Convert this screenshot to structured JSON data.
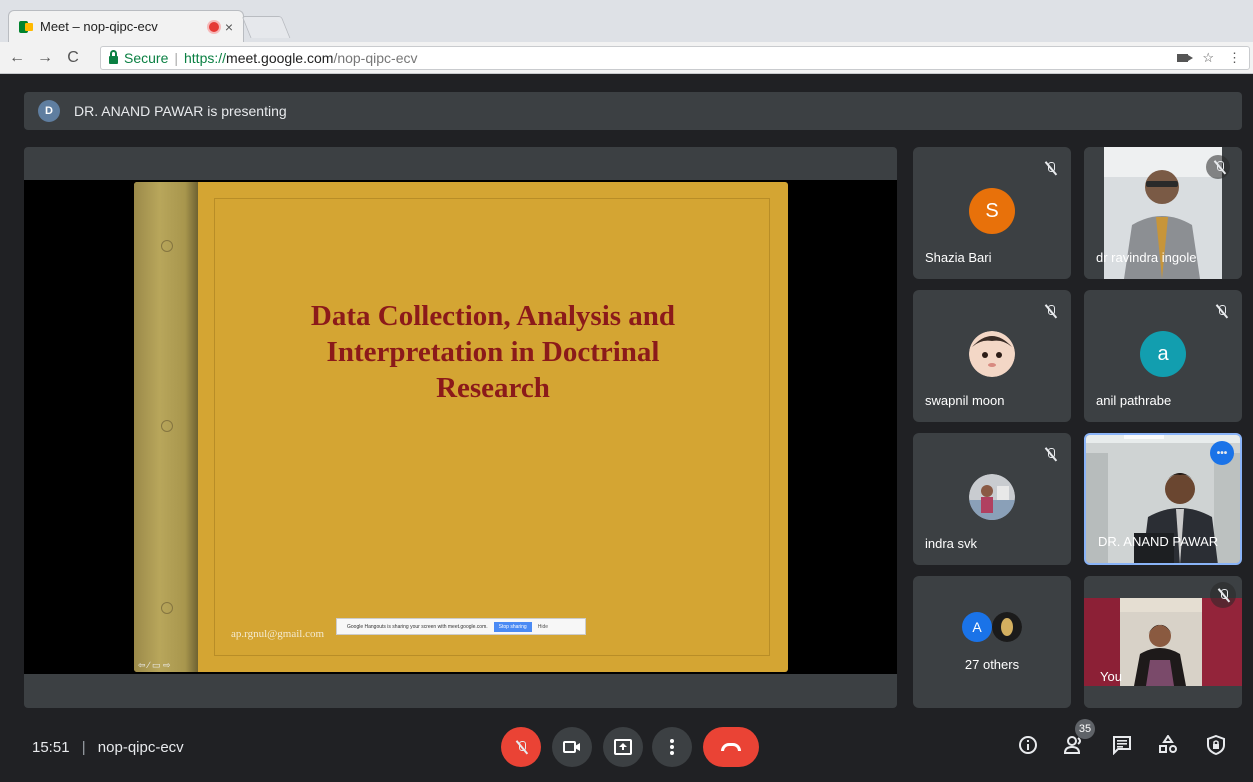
{
  "browser": {
    "tab_title": "Meet – nop-qipc-ecv",
    "tab_close": "×",
    "nav": {
      "back": "←",
      "forward": "→",
      "reload": "C"
    },
    "secure_label": "Secure",
    "url_scheme": "https://",
    "url_host": "meet.google.com",
    "url_path": "/nop-qipc-ecv",
    "star": "☆",
    "menu": "⋮"
  },
  "banner": {
    "avatar_letter": "D",
    "text": "DR. ANAND PAWAR is presenting"
  },
  "slide": {
    "title_lines": [
      "Data Collection, Analysis and",
      "Interpretation in Doctrinal",
      "Research"
    ],
    "email": "ap.rgnul@gmail.com",
    "share_notice": "Google Hangouts is sharing your screen with meet.google.com.",
    "stop_sharing": "Stop sharing",
    "hide": "Hide",
    "tools": "⇦ ∕ ▭ ⇨"
  },
  "participants": [
    {
      "name": "Shazia Bari",
      "avatar_letter": "S",
      "color": "#e8710a"
    },
    {
      "name": "dr ravindra ingole"
    },
    {
      "name": "swapnil moon"
    },
    {
      "name": "anil pathrabe",
      "avatar_letter": "a",
      "color": "#129eaf"
    },
    {
      "name": "indra svk"
    },
    {
      "name": "DR. ANAND PAWAR",
      "more": "•••"
    },
    {
      "name": "27 others",
      "avatar_letter": "A",
      "color": "#1a73e8"
    },
    {
      "name": "You"
    }
  ],
  "bottom": {
    "time": "15:51",
    "separator": "|",
    "meeting_code": "nop-qipc-ecv",
    "people_count": "35"
  },
  "colors": {
    "background": "#202124",
    "tile": "#3c4043",
    "danger": "#ea4335",
    "presenter_border": "#8ab4f8"
  }
}
